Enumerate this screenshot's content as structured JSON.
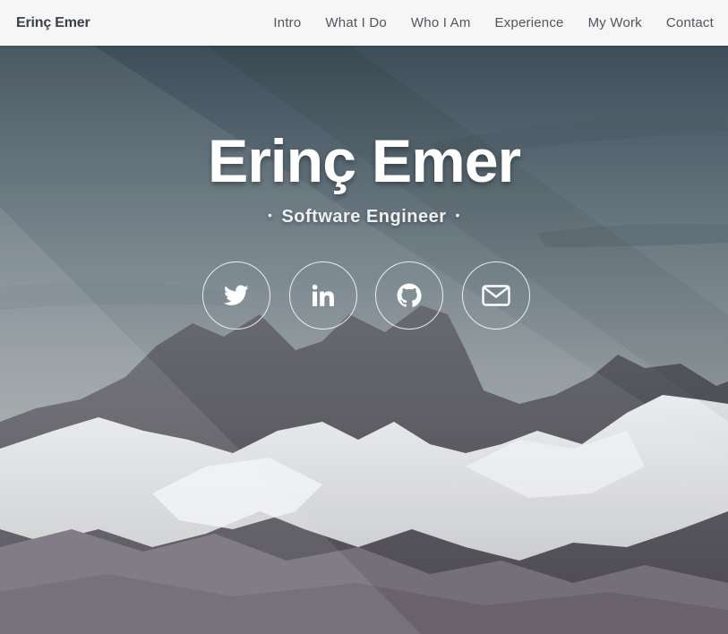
{
  "header": {
    "brand": "Erinç Emer",
    "nav": [
      "Intro",
      "What I Do",
      "Who I Am",
      "Experience",
      "My Work",
      "Contact"
    ]
  },
  "hero": {
    "title": "Erinç Emer",
    "subtitle": "Software Engineer",
    "separator": "•",
    "socials": [
      {
        "icon": "twitter-icon"
      },
      {
        "icon": "linkedin-icon"
      },
      {
        "icon": "github-icon"
      },
      {
        "icon": "email-icon"
      }
    ]
  },
  "colors": {
    "header_bg": "#f6f6f6",
    "brand_text": "#3a4248",
    "nav_text": "#4f565c",
    "hero_text": "#ffffff"
  }
}
